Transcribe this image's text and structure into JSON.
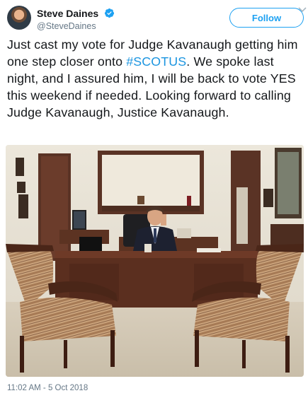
{
  "user": {
    "display_name": "Steve Daines",
    "handle": "@SteveDaines",
    "verified": true,
    "avatar_icon": "avatar-photo"
  },
  "follow_button": {
    "label": "Follow"
  },
  "tweet": {
    "text_before": "Just cast my vote for Judge Kavanaugh getting him one step closer onto ",
    "hashtag": "#SCOTUS",
    "text_after": ". We spoke last night, and I assured him, I will be back to vote YES this weekend if needed. Looking forward to calling Judge Kavanaugh, Justice Kavanaugh.",
    "timestamp": "11:02 AM - 5 Oct 2018"
  },
  "colors": {
    "accent": "#1da1f2",
    "hashtag": "#1b95e0",
    "secondary_text": "#657786"
  }
}
